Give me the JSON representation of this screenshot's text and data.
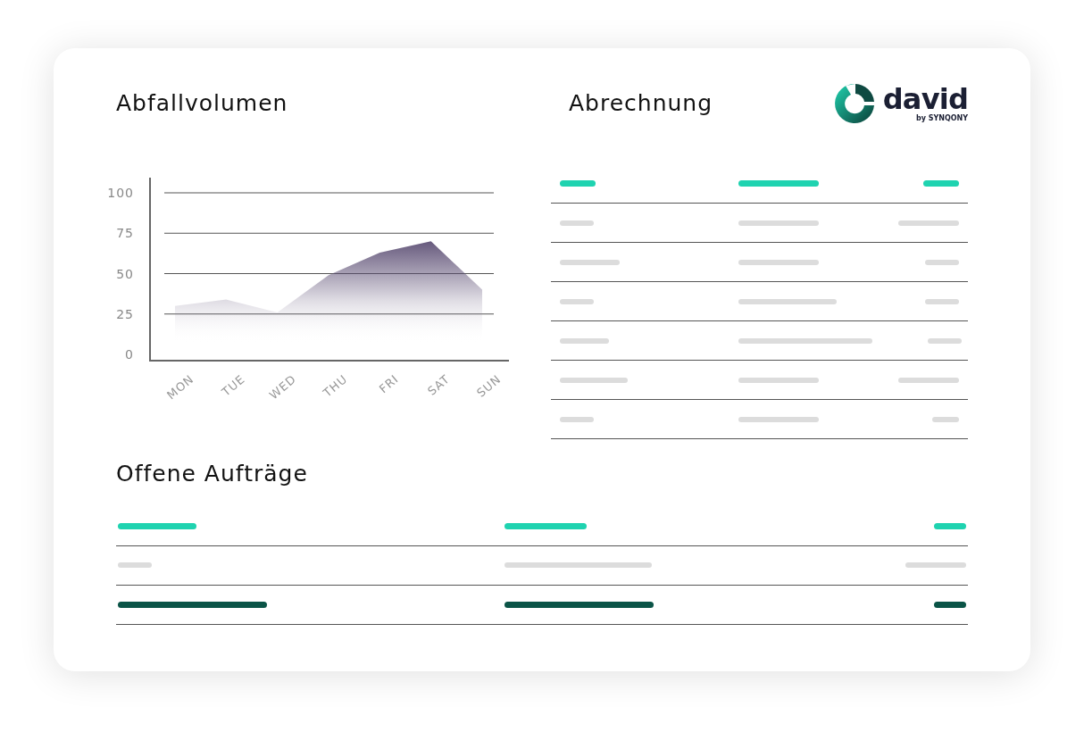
{
  "waste_volume": {
    "title": "Abfallvolumen",
    "chart_data": {
      "type": "area",
      "categories": [
        "MON",
        "TUE",
        "WED",
        "THU",
        "FRI",
        "SAT",
        "SUN"
      ],
      "series": [
        {
          "color": "#5b4d73",
          "values": [
            30,
            34,
            26,
            49,
            63,
            70,
            40
          ]
        }
      ],
      "ylim": [
        0,
        100
      ],
      "grid": true,
      "yticks": [
        0,
        25,
        50,
        75,
        100
      ]
    }
  },
  "billing": {
    "title": "Abrechnung",
    "rows": [
      {
        "kind": "header"
      },
      {
        "kind": "body"
      },
      {
        "kind": "body"
      },
      {
        "kind": "body"
      },
      {
        "kind": "body"
      },
      {
        "kind": "body"
      },
      {
        "kind": "body"
      }
    ]
  },
  "logo": {
    "name": "david",
    "byline": "by SYNQONY"
  },
  "open_orders": {
    "title": "Offene Aufträge",
    "rows": [
      {
        "kind": "header"
      },
      {
        "kind": "body"
      },
      {
        "kind": "highlight"
      }
    ]
  }
}
